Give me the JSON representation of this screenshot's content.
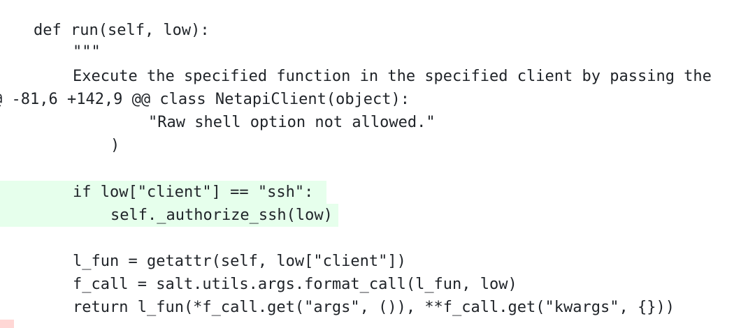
{
  "diff": {
    "lines": [
      {
        "text": "def run(self, low):",
        "indent": 48,
        "added": false
      },
      {
        "text": "\"\"\"",
        "indent": 104,
        "added": false
      },
      {
        "text": "Execute the specified function in the specified client by passing the",
        "indent": 104,
        "added": false
      },
      {
        "text": "@ -81,6 +142,9 @@ class NetapiClient(object):",
        "indent": -10,
        "added": false,
        "hunk": true
      },
      {
        "text": "\"Raw shell option not allowed.\"",
        "indent": 212,
        "added": false
      },
      {
        "text": ")",
        "indent": 158,
        "added": false
      },
      {
        "text": "",
        "indent": 0,
        "added": false
      },
      {
        "text": "if low[\"client\"] == \"ssh\":",
        "indent": 104,
        "added": true
      },
      {
        "text": "self._authorize_ssh(low)",
        "indent": 158,
        "added": true
      },
      {
        "text": "",
        "indent": 0,
        "added": false
      },
      {
        "text": "l_fun = getattr(self, low[\"client\"])",
        "indent": 104,
        "added": false
      },
      {
        "text": "f_call = salt.utils.args.format_call(l_fun, low)",
        "indent": 104,
        "added": false
      },
      {
        "text": "return l_fun(*f_call.get(\"args\", ()), **f_call.get(\"kwargs\", {}))",
        "indent": 104,
        "added": false
      }
    ]
  },
  "colors": {
    "added_bg": "#e6ffec",
    "removed_marker": "#ffd7d5",
    "text": "#1f2328"
  }
}
